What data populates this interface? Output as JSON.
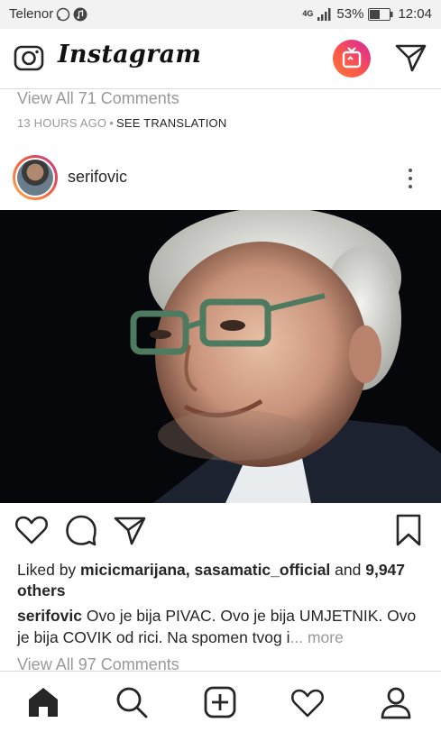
{
  "status_bar": {
    "carrier": "Telenor",
    "network": "4G",
    "battery": "53%",
    "time": "12:04"
  },
  "header": {
    "logo": "Instagram",
    "icons": [
      "camera-icon",
      "igtv-icon",
      "direct-message-icon"
    ]
  },
  "previous_post": {
    "view_comments": "View All 71 Comments",
    "time_ago": "13 HOURS AGO",
    "separator": "•",
    "translation": "SEE TRANSLATION"
  },
  "post": {
    "username": "serifovic",
    "likes": {
      "prefix": "Liked by ",
      "user1": "micicmarijana",
      "sep": ", ",
      "user2": "sasamatic_official",
      "and": " and ",
      "count": "9,947 others"
    },
    "caption": {
      "username": "serifovic",
      "text": " Ovo je bija PIVAC. Ovo je bija UMJETNIK. Ovo je bija COVIK od rici. Na spomen tvog i",
      "more": "... more"
    },
    "view_comments": "View All 97 Comments"
  },
  "bottom_nav": {
    "items": [
      "home-icon",
      "search-icon",
      "add-post-icon",
      "activity-icon",
      "profile-icon"
    ]
  },
  "colors": {
    "text": "#262626",
    "muted": "#999999",
    "igtv_gradient": [
      "#f77737",
      "#d6249f"
    ]
  }
}
